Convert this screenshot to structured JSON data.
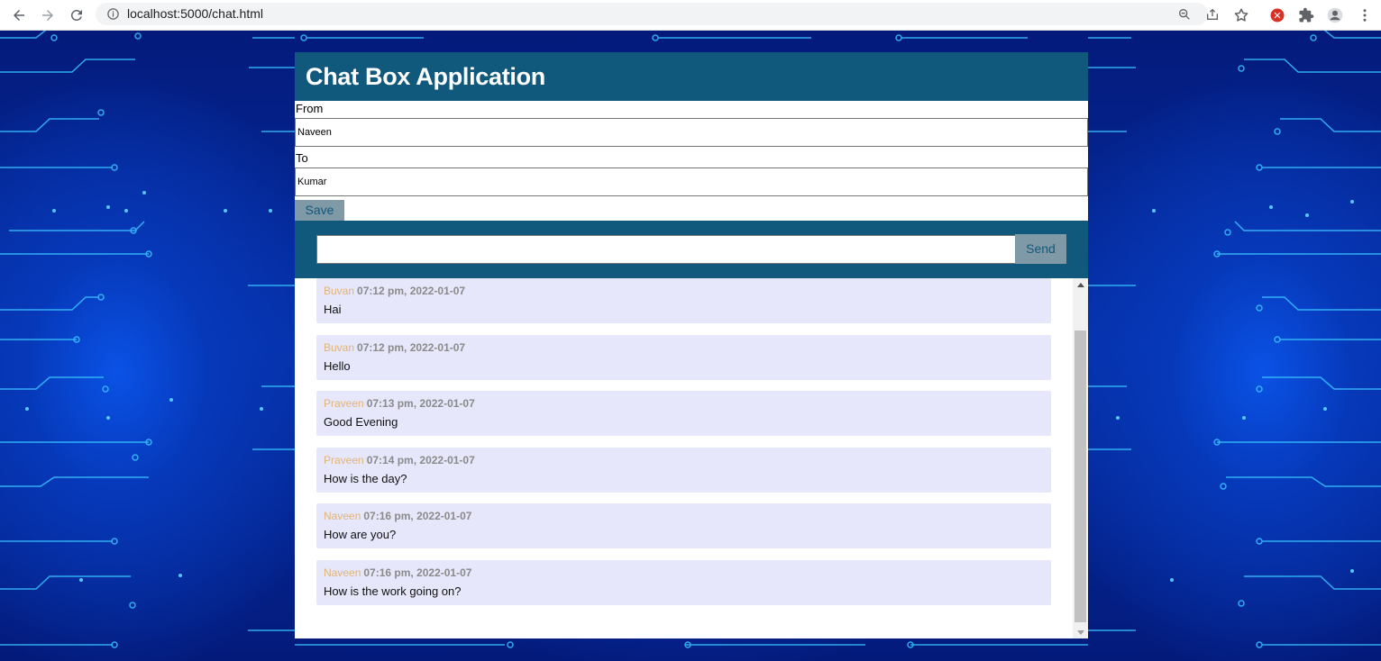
{
  "browser": {
    "url": "localhost:5000/chat.html",
    "back_icon": "arrow-left-icon",
    "forward_icon": "arrow-right-icon",
    "reload_icon": "reload-icon"
  },
  "app": {
    "title": "Chat Box Application",
    "header_color": "#11587d"
  },
  "form": {
    "from_label": "From",
    "from_value": "Naveen",
    "to_label": "To",
    "to_value": "Kumar",
    "save_label": "Save"
  },
  "compose": {
    "value": "",
    "send_label": "Send"
  },
  "messages": [
    {
      "sender": "Buvan",
      "time": "07:12 pm, 2022-01-07",
      "text": "Hai"
    },
    {
      "sender": "Buvan",
      "time": "07:12 pm, 2022-01-07",
      "text": "Hello"
    },
    {
      "sender": "Praveen",
      "time": "07:13 pm, 2022-01-07",
      "text": "Good Evening"
    },
    {
      "sender": "Praveen",
      "time": "07:14 pm, 2022-01-07",
      "text": "How is the day?"
    },
    {
      "sender": "Naveen",
      "time": "07:16 pm, 2022-01-07",
      "text": "How are you?"
    },
    {
      "sender": "Naveen",
      "time": "07:16 pm, 2022-01-07",
      "text": "How is the work going on?"
    }
  ],
  "colors": {
    "sender": "#e0b479",
    "message_bg": "#e6e7fb",
    "button_bg": "#7f9aa6"
  }
}
